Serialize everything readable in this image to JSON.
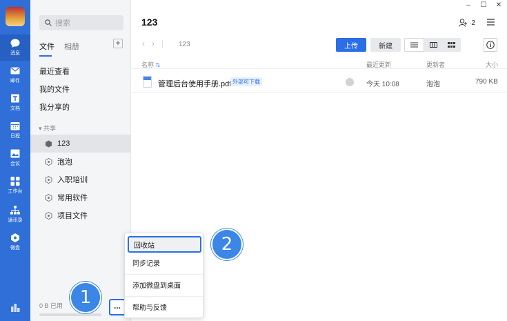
{
  "rail": {
    "items": [
      {
        "label": "消息",
        "icon": "chat-bubble-icon"
      },
      {
        "label": "邮件",
        "icon": "mail-icon"
      },
      {
        "label": "文档",
        "icon": "document-icon"
      },
      {
        "label": "日程",
        "icon": "calendar-icon"
      },
      {
        "label": "会议",
        "icon": "meeting-icon"
      },
      {
        "label": "工作台",
        "icon": "workbench-icon"
      },
      {
        "label": "通讯录",
        "icon": "contacts-icon"
      },
      {
        "label": "微盘",
        "icon": "drive-icon"
      }
    ]
  },
  "sidebar": {
    "search_placeholder": "搜索",
    "tabs": [
      "文件",
      "相册"
    ],
    "nav": [
      "最近查看",
      "我的文件",
      "我分享的"
    ],
    "section_label": "共享",
    "shared": [
      "123",
      "泡泡",
      "入职培训",
      "常用软件",
      "项目文件"
    ],
    "usage": "0 B 已用",
    "more_label": "..."
  },
  "main": {
    "title": "123",
    "users_count": "2",
    "breadcrumb": "123",
    "upload_label": "上传",
    "new_label": "新建",
    "columns": {
      "name": "名称",
      "modified": "最近更新",
      "updater": "更新者",
      "size": "大小"
    },
    "files": [
      {
        "name": "管理后台使用手册.pdf",
        "tag": "外部可下载",
        "modified": "今天 10:08",
        "updater": "泡泡",
        "size": "790 KB"
      }
    ]
  },
  "popup": {
    "items": [
      "回收站",
      "同步记录",
      "添加微盘到桌面",
      "帮助与反馈"
    ]
  },
  "callouts": [
    "1",
    "2"
  ],
  "colors": {
    "rail": "#2f6fd7",
    "accent": "#2b6ee6"
  }
}
